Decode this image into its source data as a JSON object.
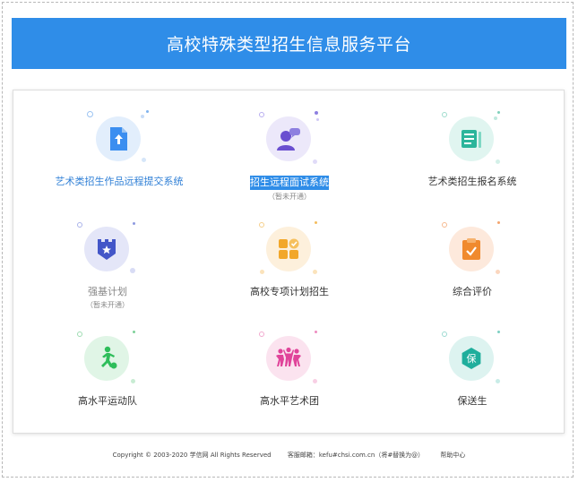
{
  "header": {
    "title": "高校特殊类型招生信息服务平台"
  },
  "items": [
    {
      "label": "艺术类招生作品远程提交系统",
      "sub": "",
      "icon": "upload-file-icon",
      "color": "#3b8ef0",
      "bg": "#e2eefc"
    },
    {
      "label": "招生远程面试系统",
      "sub": "（暂未开通）",
      "icon": "interview-icon",
      "color": "#6a4fd0",
      "bg": "#ece8fa"
    },
    {
      "label": "艺术类招生报名系统",
      "sub": "",
      "icon": "registration-form-icon",
      "color": "#2bb59b",
      "bg": "#e0f5f0"
    },
    {
      "label": "强基计划",
      "sub": "（暂未开通）",
      "icon": "castle-star-icon",
      "color": "#4356c8",
      "bg": "#e4e6f8"
    },
    {
      "label": "高校专项计划招生",
      "sub": "",
      "icon": "grid-check-icon",
      "color": "#f2a72a",
      "bg": "#fdf0dc"
    },
    {
      "label": "综合评价",
      "sub": "",
      "icon": "clipboard-check-icon",
      "color": "#f08a2e",
      "bg": "#fde9dc"
    },
    {
      "label": "高水平运动队",
      "sub": "",
      "icon": "athlete-icon",
      "color": "#2ebd5a",
      "bg": "#e0f5e6"
    },
    {
      "label": "高水平艺术团",
      "sub": "",
      "icon": "dancers-icon",
      "color": "#e0449a",
      "bg": "#fbe3ef"
    },
    {
      "label": "保送生",
      "sub": "",
      "icon": "bao-badge-icon",
      "color": "#1fae9c",
      "bg": "#ddf3f0",
      "badge": "保"
    }
  ],
  "footer": {
    "copyright": "Copyright © 2003-2020 学信网 All Rights Reserved",
    "contact": "客服邮箱：kefu#chsi.com.cn（将#替换为@）",
    "help": "帮助中心"
  }
}
